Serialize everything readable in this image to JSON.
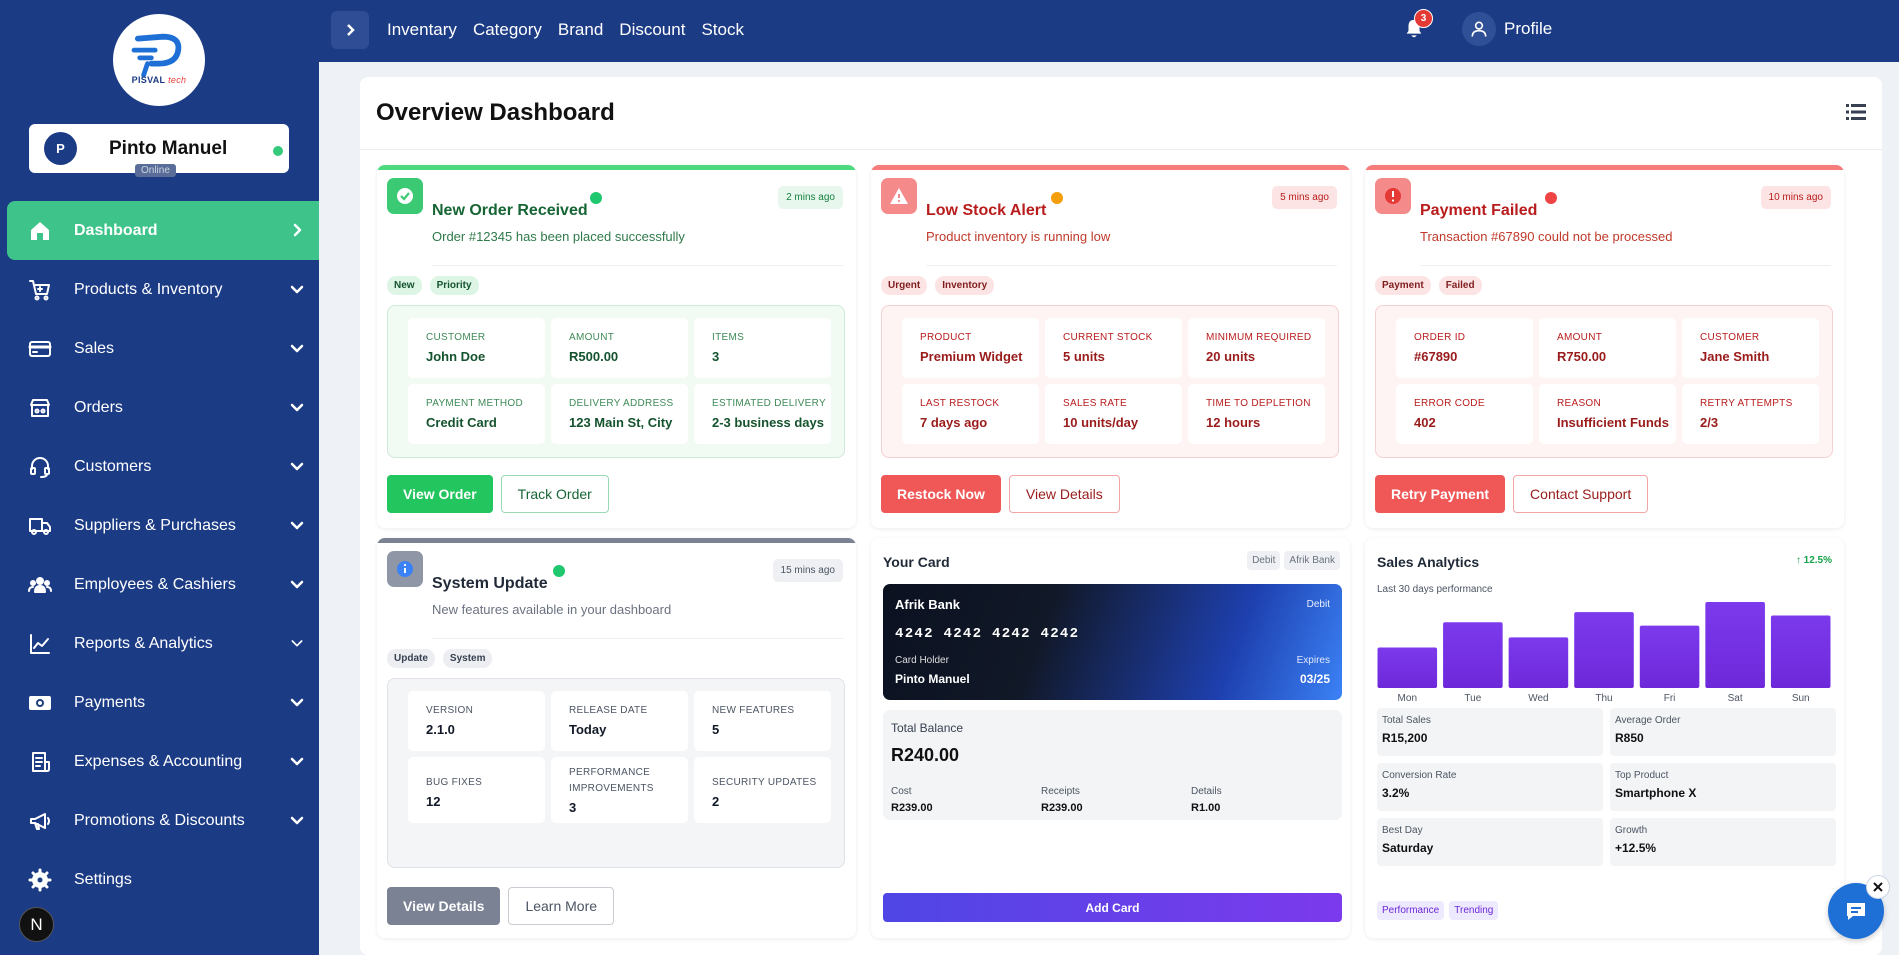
{
  "brand": {
    "name": "PISVAL",
    "suffix": "tech"
  },
  "user": {
    "initial": "P",
    "name": "Pinto Manuel",
    "status": "Online"
  },
  "sidebar": {
    "items": [
      {
        "label": "Dashboard",
        "icon": "home-icon"
      },
      {
        "label": "Products & Inventory",
        "icon": "cart-icon"
      },
      {
        "label": "Sales",
        "icon": "credit-card-icon"
      },
      {
        "label": "Orders",
        "icon": "store-icon"
      },
      {
        "label": "Customers",
        "icon": "headset-icon"
      },
      {
        "label": "Suppliers & Purchases",
        "icon": "truck-icon"
      },
      {
        "label": "Employees & Cashiers",
        "icon": "users-icon"
      },
      {
        "label": "Reports & Analytics",
        "icon": "chart-line-icon"
      },
      {
        "label": "Payments",
        "icon": "money-icon"
      },
      {
        "label": "Expenses & Accounting",
        "icon": "receipt-icon"
      },
      {
        "label": "Promotions & Discounts",
        "icon": "megaphone-icon"
      },
      {
        "label": "Settings",
        "icon": "gear-icon"
      }
    ],
    "footer_badge": "N"
  },
  "topbar": {
    "links": [
      "Inventary",
      "Category",
      "Brand",
      "Discount",
      "Stock"
    ],
    "notifications": "3",
    "profile": "Profile"
  },
  "page": {
    "title": "Overview Dashboard"
  },
  "cards": {
    "order": {
      "title": "New Order Received",
      "time": "2 mins ago",
      "subtitle": "Order #12345 has been placed successfully",
      "tags": [
        "New",
        "Priority"
      ],
      "fields": [
        {
          "k": "CUSTOMER",
          "v": "John Doe"
        },
        {
          "k": "AMOUNT",
          "v": "R500.00"
        },
        {
          "k": "ITEMS",
          "v": "3"
        },
        {
          "k": "PAYMENT METHOD",
          "v": "Credit Card"
        },
        {
          "k": "DELIVERY ADDRESS",
          "v": "123 Main St, City"
        },
        {
          "k": "ESTIMATED DELIVERY",
          "v": "2-3 business days"
        }
      ],
      "primary": "View Order",
      "secondary": "Track Order"
    },
    "stock": {
      "title": "Low Stock Alert",
      "time": "5 mins ago",
      "subtitle": "Product inventory is running low",
      "tags": [
        "Urgent",
        "Inventory"
      ],
      "fields": [
        {
          "k": "PRODUCT",
          "v": "Premium Widget"
        },
        {
          "k": "CURRENT STOCK",
          "v": "5 units"
        },
        {
          "k": "MINIMUM REQUIRED",
          "v": "20 units"
        },
        {
          "k": "LAST RESTOCK",
          "v": "7 days ago"
        },
        {
          "k": "SALES RATE",
          "v": "10 units/day"
        },
        {
          "k": "TIME TO DEPLETION",
          "v": "12 hours"
        }
      ],
      "primary": "Restock Now",
      "secondary": "View Details"
    },
    "payment": {
      "title": "Payment Failed",
      "time": "10 mins ago",
      "subtitle": "Transaction #67890 could not be processed",
      "tags": [
        "Payment",
        "Failed"
      ],
      "fields": [
        {
          "k": "ORDER ID",
          "v": "#67890"
        },
        {
          "k": "AMOUNT",
          "v": "R750.00"
        },
        {
          "k": "CUSTOMER",
          "v": "Jane Smith"
        },
        {
          "k": "ERROR CODE",
          "v": "402"
        },
        {
          "k": "REASON",
          "v": "Insufficient Funds"
        },
        {
          "k": "RETRY ATTEMPTS",
          "v": "2/3"
        }
      ],
      "primary": "Retry Payment",
      "secondary": "Contact Support"
    },
    "system": {
      "title": "System Update",
      "time": "15 mins ago",
      "subtitle": "New features available in your dashboard",
      "tags": [
        "Update",
        "System"
      ],
      "fields": [
        {
          "k": "VERSION",
          "v": "2.1.0"
        },
        {
          "k": "RELEASE DATE",
          "v": "Today"
        },
        {
          "k": "NEW FEATURES",
          "v": "5"
        },
        {
          "k": "BUG FIXES",
          "v": "12"
        },
        {
          "k": "PERFORMANCE IMPROVEMENTS",
          "v": "3"
        },
        {
          "k": "SECURITY UPDATES",
          "v": "2"
        }
      ],
      "primary": "View Details",
      "secondary": "Learn More"
    }
  },
  "your_card": {
    "title": "Your Card",
    "tags": [
      "Debit",
      "Afrik Bank"
    ],
    "bank": "Afrik Bank",
    "type": "Debit",
    "number": "4242 4242 4242 4242",
    "holder_label": "Card Holder",
    "holder": "Pinto Manuel",
    "expires_label": "Expires",
    "expires": "03/25",
    "balance_label": "Total Balance",
    "balance": "R240.00",
    "cols": [
      {
        "k": "Cost",
        "v": "R239.00"
      },
      {
        "k": "Receipts",
        "v": "R239.00"
      },
      {
        "k": "Details",
        "v": "R1.00"
      }
    ],
    "add_button": "Add Card"
  },
  "analytics": {
    "title": "Sales Analytics",
    "growth": "↑ 12.5%",
    "subtitle": "Last 30 days performance",
    "stats": [
      {
        "k": "Total Sales",
        "v": "R15,200"
      },
      {
        "k": "Average Order",
        "v": "R850"
      },
      {
        "k": "Conversion Rate",
        "v": "3.2%"
      },
      {
        "k": "Top Product",
        "v": "Smartphone X"
      },
      {
        "k": "Best Day",
        "v": "Saturday"
      },
      {
        "k": "Growth",
        "v": "+12.5%"
      }
    ],
    "tags": [
      "Performance",
      "Trending"
    ]
  },
  "chart_data": {
    "type": "bar",
    "categories": [
      "Mon",
      "Tue",
      "Wed",
      "Thu",
      "Fri",
      "Sat",
      "Sun"
    ],
    "values": [
      48,
      78,
      60,
      90,
      74,
      102,
      86
    ],
    "ylim": [
      0,
      102
    ],
    "title": "",
    "xlabel": "",
    "ylabel": "",
    "grid": false,
    "legend": "none"
  },
  "colors": {
    "sidebar": "#1c3b85",
    "active": "#3ec38a",
    "success": "#22c55e",
    "danger": "#f05858",
    "bar": "#7c3aed"
  }
}
